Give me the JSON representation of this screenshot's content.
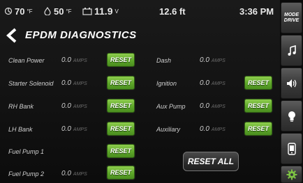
{
  "status_bar": {
    "temp1_value": "70",
    "temp1_unit": "°F",
    "temp2_value": "50",
    "temp2_unit": "°F",
    "battery_value": "11.9",
    "battery_unit": "V",
    "distance": "12.6 ft",
    "time": "3:36 PM"
  },
  "header": {
    "title": "EPDM DIAGNOSTICS"
  },
  "units": "AMPS",
  "left_column": [
    {
      "label": "Clean Power",
      "value": "0.0",
      "button": "RESET"
    },
    {
      "label": "Starter Solenoid",
      "value": "0.0",
      "button": "RESET"
    },
    {
      "label": "RH Bank",
      "value": "0.0",
      "button": "RESET"
    },
    {
      "label": "LH Bank",
      "value": "0.0",
      "button": "RESET"
    },
    {
      "label": "Fuel Pump 1",
      "value": "",
      "button": "RESET"
    },
    {
      "label": "Fuel Pump 2",
      "value": "0.0",
      "button": "RESET"
    }
  ],
  "right_column": [
    {
      "label": "Dash",
      "value": "0.0"
    },
    {
      "label": "Ignition",
      "value": "0.0",
      "button": "RESET"
    },
    {
      "label": "Aux Pump",
      "value": "0.0",
      "button": "RESET"
    },
    {
      "label": "Auxiliary",
      "value": "0.0",
      "button": "RESET"
    }
  ],
  "reset_all_label": "RESET ALL",
  "sidebar": {
    "mode_line1": "MODE",
    "mode_line2": "DRIVE",
    "icons": [
      "music-note-icon",
      "speaker-icon",
      "lightbulb-icon",
      "phone-icon",
      "gear-icon"
    ]
  },
  "colors": {
    "reset_green": "#6bb233",
    "gear_green": "#7dc243",
    "background": "#111111"
  }
}
